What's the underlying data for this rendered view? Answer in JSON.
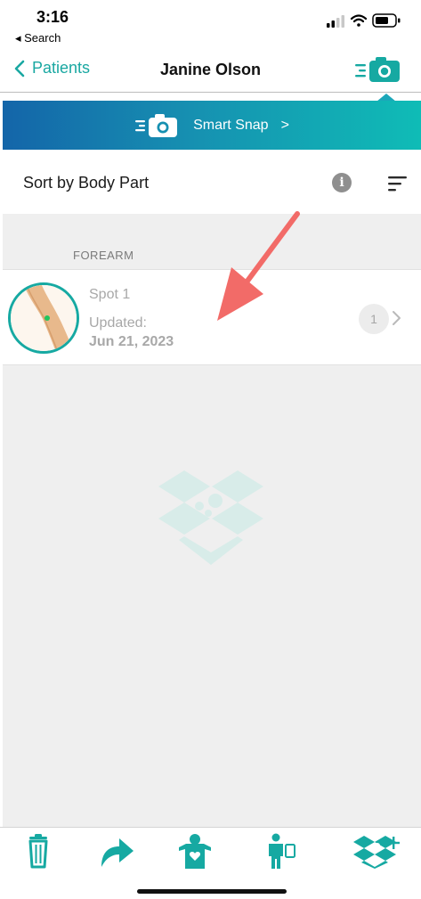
{
  "status_bar": {
    "time": "3:16",
    "back_label": "◂ Search"
  },
  "nav": {
    "back_label": "Patients",
    "title": "Janine Olson"
  },
  "smart_snap": {
    "label": "Smart Snap",
    "chevron": ">"
  },
  "sort": {
    "label": "Sort by Body Part",
    "info_glyph": "i"
  },
  "section": {
    "header": "FOREARM"
  },
  "spot": {
    "name": "Spot 1",
    "updated_label": "Updated:",
    "date": "Jun 21, 2023",
    "count": "1"
  },
  "colors": {
    "accent": "#16a9a2",
    "banner_start": "#1465a9",
    "banner_end": "#0fbcb6",
    "annotation": "#f26b68",
    "marker": "#22c55e"
  },
  "icons": [
    "camera-icon",
    "trash-icon",
    "share-icon",
    "patient-icon",
    "body-scan-icon",
    "add-box-icon",
    "info-icon",
    "sort-icon"
  ]
}
